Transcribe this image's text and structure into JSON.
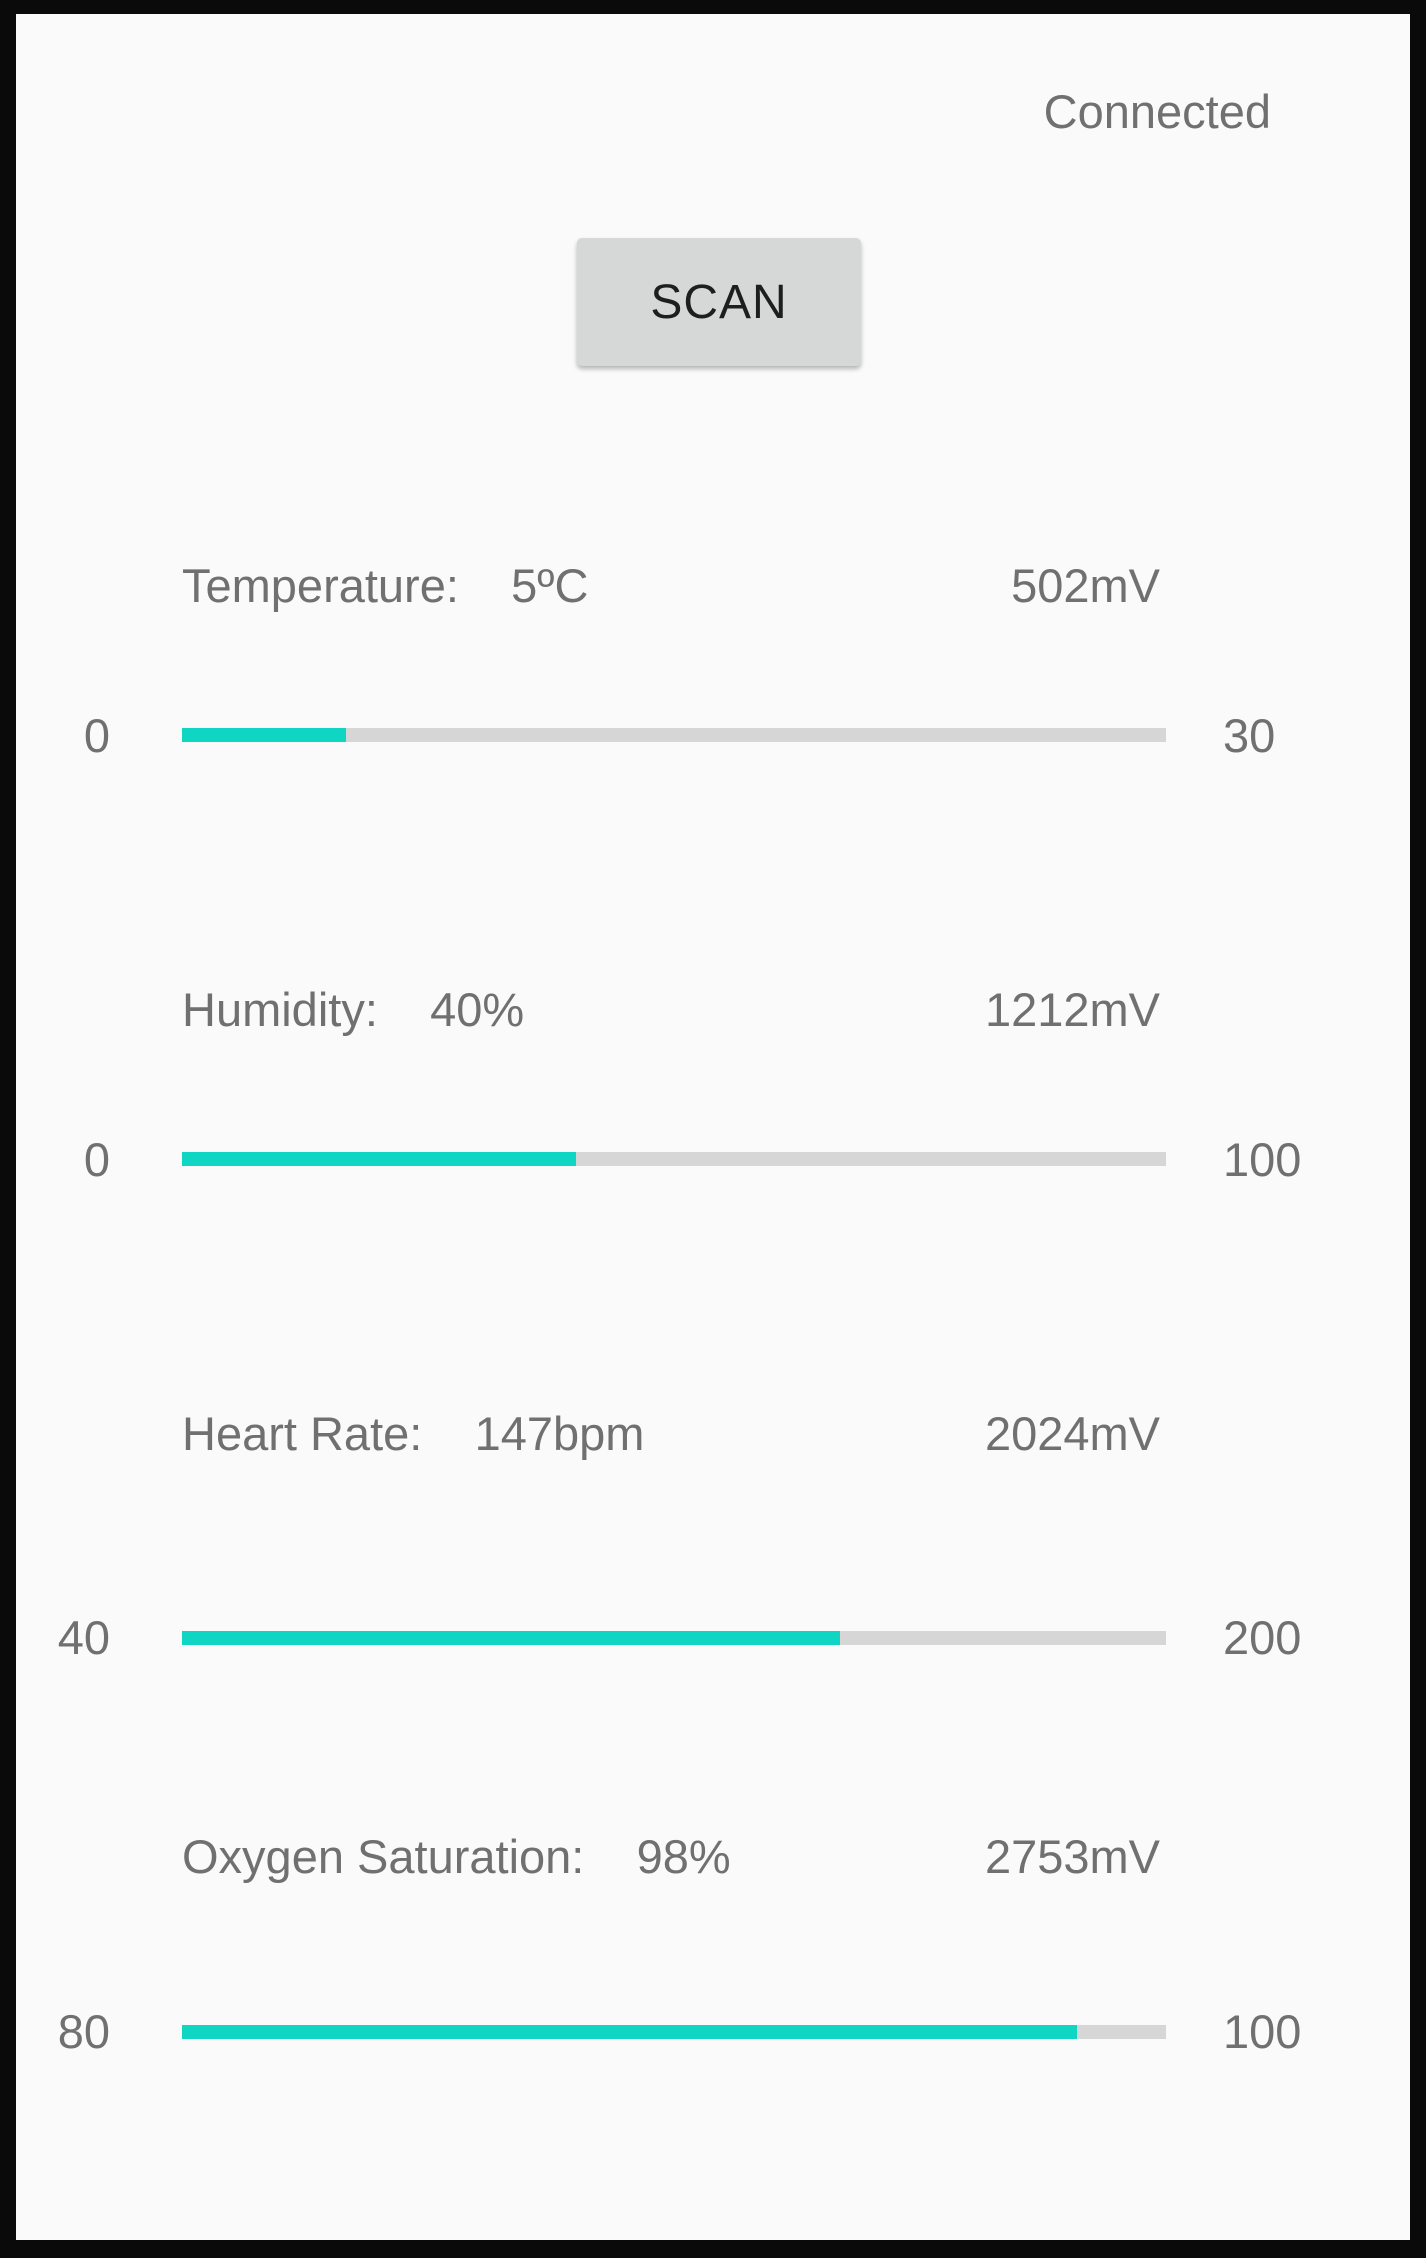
{
  "header": {
    "status": "Connected",
    "scan_label": "SCAN"
  },
  "colors": {
    "accent": "#0fd6c2",
    "track": "#d6d6d6",
    "text": "#707070",
    "background": "#fafafa"
  },
  "sensors": [
    {
      "label": "Temperature:",
      "value": "5ºC",
      "voltage": "502mV",
      "min": "0",
      "max": "30",
      "fill": 0.167
    },
    {
      "label": "Humidity:",
      "value": "40%",
      "voltage": "1212mV",
      "min": "0",
      "max": "100",
      "fill": 0.4
    },
    {
      "label": "Heart Rate:",
      "value": "147bpm",
      "voltage": "2024mV",
      "min": "40",
      "max": "200",
      "fill": 0.669
    },
    {
      "label": "Oxygen Saturation:",
      "value": "98%",
      "voltage": "2753mV",
      "min": "80",
      "max": "100",
      "fill": 0.91
    }
  ]
}
